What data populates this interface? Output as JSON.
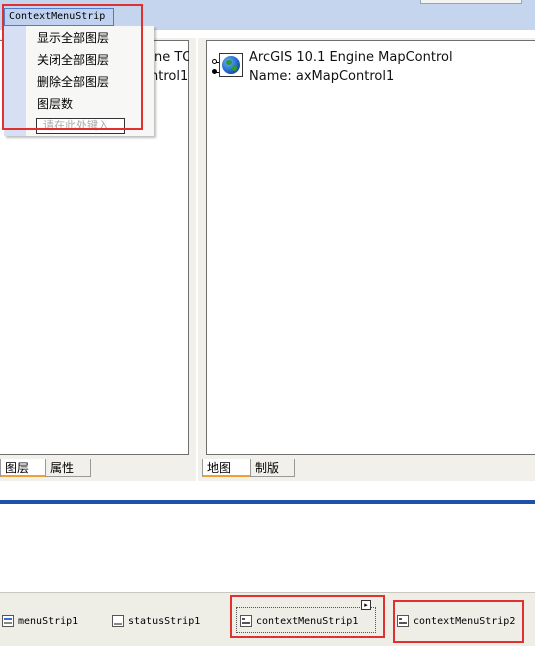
{
  "context_menu": {
    "header": "ContextMenuStrip",
    "items": [
      "显示全部图层",
      "关闭全部图层",
      "删除全部图层",
      "图层数"
    ],
    "input_placeholder": "请在此处键入"
  },
  "toc_control": {
    "line1_fragment": "ne TOC",
    "line2_fragment": "ntrol1"
  },
  "map_control": {
    "title": "ArcGIS 10.1 Engine MapControl",
    "name_line": "Name: axMapControl1"
  },
  "left_tabs": [
    "图层",
    "属性"
  ],
  "right_tabs": [
    "地图",
    "制版"
  ],
  "component_tray": {
    "items": [
      "menuStrip1",
      "statusStrip1",
      "contextMenuStrip1",
      "contextMenuStrip2"
    ]
  },
  "colors": {
    "highlight_box": "#e03030",
    "designer_band": "#c6d5ee",
    "tab_accent": "#f0a030"
  }
}
